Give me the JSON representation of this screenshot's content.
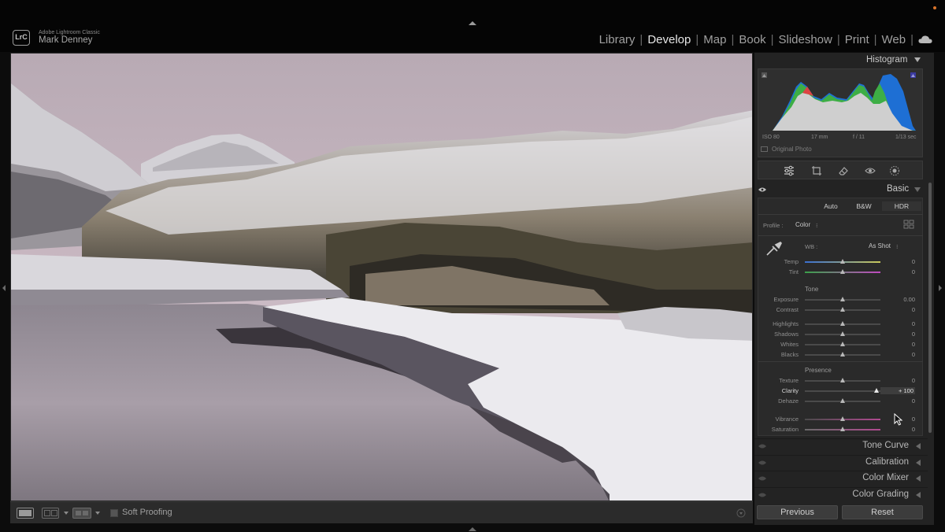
{
  "app": {
    "logo": "LrC",
    "app_name": "Adobe Lightroom Classic",
    "user_name": "Mark Denney"
  },
  "modules": [
    {
      "label": "Library",
      "active": false
    },
    {
      "label": "Develop",
      "active": true
    },
    {
      "label": "Map",
      "active": false
    },
    {
      "label": "Book",
      "active": false
    },
    {
      "label": "Slideshow",
      "active": false
    },
    {
      "label": "Print",
      "active": false
    },
    {
      "label": "Web",
      "active": false
    }
  ],
  "toolbar": {
    "soft_proofing_label": "Soft Proofing"
  },
  "histogram": {
    "title": "Histogram",
    "iso": "ISO 80",
    "focal": "17 mm",
    "aperture": "f / 11",
    "shutter": "1/13 sec",
    "original_photo_label": "Original Photo"
  },
  "basic": {
    "title": "Basic",
    "auto_label": "Auto",
    "bw_label": "B&W",
    "hdr_label": "HDR",
    "profile_label": "Profile :",
    "profile_value": "Color",
    "wb_label": "WB :",
    "wb_value": "As Shot",
    "tone_title": "Tone",
    "presence_title": "Presence",
    "wb_rows": [
      {
        "label": "Temp",
        "value": "0",
        "position": 0.5
      },
      {
        "label": "Tint",
        "value": "0",
        "position": 0.5
      }
    ],
    "tone_rows": [
      {
        "label": "Exposure",
        "value": "0.00",
        "position": 0.5
      },
      {
        "label": "Contrast",
        "value": "0",
        "position": 0.5
      }
    ],
    "tone_rows2": [
      {
        "label": "Highlights",
        "value": "0",
        "position": 0.5
      },
      {
        "label": "Shadows",
        "value": "0",
        "position": 0.5
      },
      {
        "label": "Whites",
        "value": "0",
        "position": 0.5
      },
      {
        "label": "Blacks",
        "value": "0",
        "position": 0.5
      }
    ],
    "presence_rows": [
      {
        "label": "Texture",
        "value": "0",
        "position": 0.5
      },
      {
        "label": "Clarity",
        "value": "+ 100",
        "position": 0.95
      },
      {
        "label": "Dehaze",
        "value": "0",
        "position": 0.5
      }
    ],
    "presence_rows2": [
      {
        "label": "Vibrance",
        "value": "0",
        "position": 0.5
      },
      {
        "label": "Saturation",
        "value": "0",
        "position": 0.5
      }
    ]
  },
  "collapsed_panels": [
    "Tone Curve",
    "Calibration",
    "Color Mixer",
    "Color Grading"
  ],
  "footer": {
    "previous_label": "Previous",
    "reset_label": "Reset"
  }
}
